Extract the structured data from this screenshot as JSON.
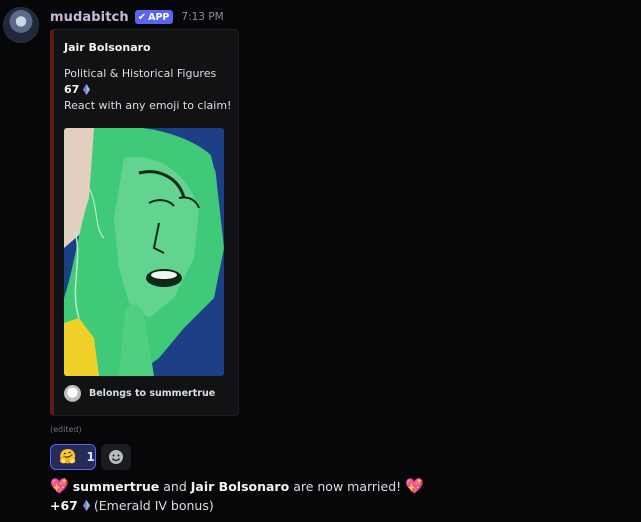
{
  "message": {
    "username": "mudabitch",
    "app_badge": "APP",
    "app_badge_check": "✔",
    "timestamp": "7:13 PM",
    "edited": "(edited)"
  },
  "embed": {
    "title": "Jair Bolsonaro",
    "category": "Political & Historical Figures",
    "value": "67",
    "instruction": "React with any emoji to claim!",
    "footer": "Belongs to summertrue",
    "accent_color": "#5d1b16"
  },
  "reactions": [
    {
      "emoji": "🤗",
      "count": "1",
      "selected": true
    }
  ],
  "result": {
    "user": "summertrue",
    "middle": "and",
    "character": "Jair Bolsonaro",
    "tail": "are now married!",
    "bonus_amount": "+67",
    "bonus_label": "(Emerald IV bonus)"
  },
  "icons": {
    "heart": "💖",
    "gem": "gem-icon",
    "add_reaction": "add-reaction-icon"
  },
  "colors": {
    "background": "#070709",
    "badge": "#5865f2",
    "username": "#c9b8dc",
    "reaction_border": "#5865f2"
  }
}
